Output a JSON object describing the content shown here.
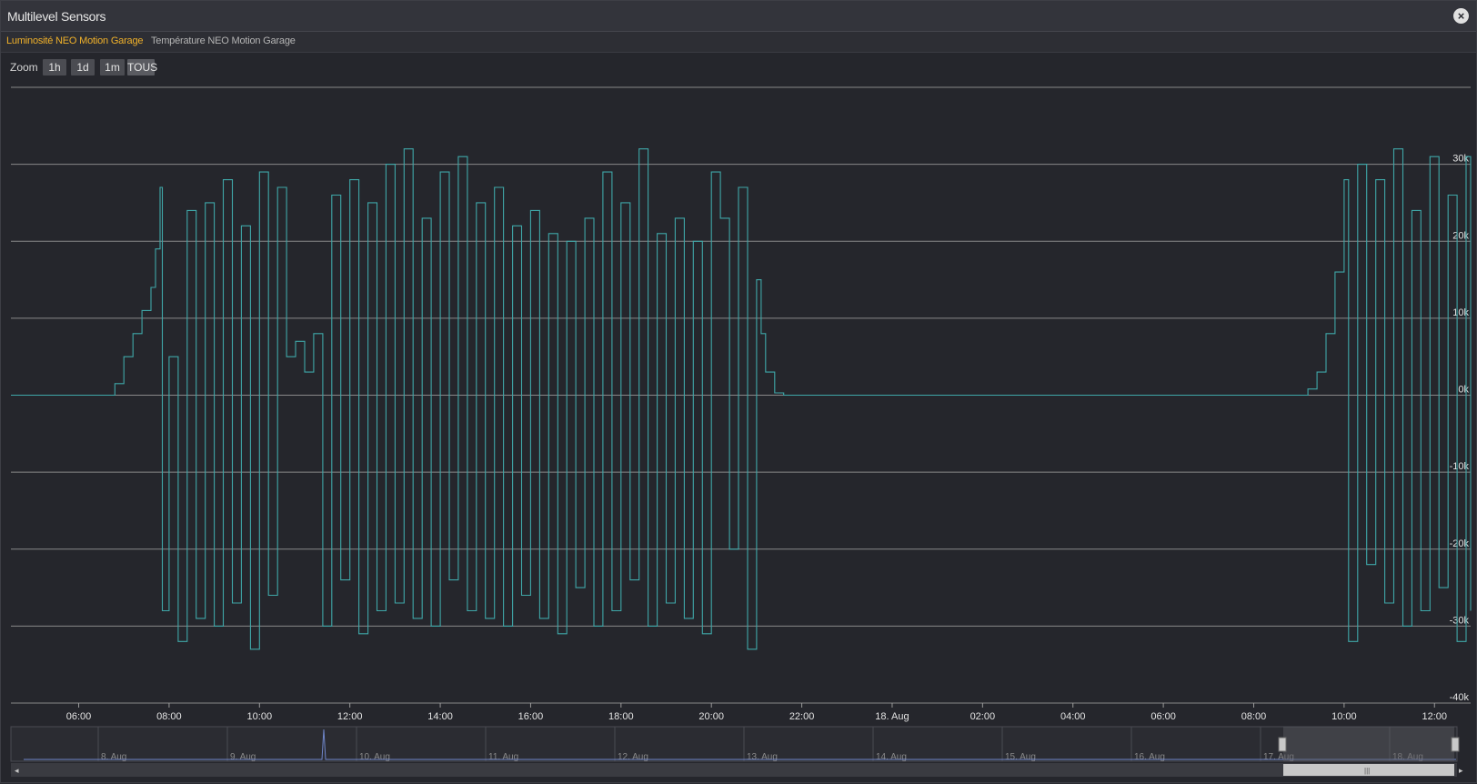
{
  "window": {
    "title": "Multilevel Sensors"
  },
  "tabs": [
    {
      "label": "Luminosité NEO Motion Garage"
    },
    {
      "label": "Température NEO Motion Garage"
    }
  ],
  "zoom": {
    "label": "Zoom",
    "buttons": [
      "1h",
      "1d",
      "1m",
      "TOUS"
    ]
  },
  "colors": {
    "series": "#3fa7a8",
    "active_tab": "#f0b12a",
    "nav_line": "#6f86c9"
  },
  "chart_data": {
    "type": "line",
    "title": "",
    "xlabel": "",
    "ylabel": "",
    "ylim": [
      -40000,
      40000
    ],
    "yticks": [
      "30k",
      "20k",
      "10k",
      "0k",
      "-10k",
      "-20k",
      "-30k",
      "-40k"
    ],
    "x_tick_labels": [
      "06:00",
      "08:00",
      "10:00",
      "12:00",
      "14:00",
      "16:00",
      "18:00",
      "20:00",
      "22:00",
      "18. Aug",
      "02:00",
      "04:00",
      "06:00",
      "08:00",
      "10:00",
      "12:00"
    ],
    "x_range_hours": [
      4.5,
      36.8
    ],
    "grid": true,
    "series": [
      {
        "points": [
          [
            4.5,
            0
          ],
          [
            6.6,
            0
          ],
          [
            6.8,
            1500
          ],
          [
            7.0,
            5000
          ],
          [
            7.2,
            8000
          ],
          [
            7.4,
            11000
          ],
          [
            7.6,
            14000
          ],
          [
            7.7,
            19000
          ],
          [
            7.8,
            27000
          ],
          [
            7.85,
            -28000
          ],
          [
            8.0,
            5000
          ],
          [
            8.2,
            -32000
          ],
          [
            8.4,
            24000
          ],
          [
            8.6,
            -29000
          ],
          [
            8.8,
            25000
          ],
          [
            9.0,
            -30000
          ],
          [
            9.2,
            28000
          ],
          [
            9.4,
            -27000
          ],
          [
            9.6,
            22000
          ],
          [
            9.8,
            -33000
          ],
          [
            10.0,
            29000
          ],
          [
            10.2,
            -26000
          ],
          [
            10.4,
            27000
          ],
          [
            10.6,
            5000
          ],
          [
            10.8,
            7000
          ],
          [
            11.0,
            3000
          ],
          [
            11.2,
            8000
          ],
          [
            11.4,
            -30000
          ],
          [
            11.6,
            26000
          ],
          [
            11.8,
            -24000
          ],
          [
            12.0,
            28000
          ],
          [
            12.2,
            -31000
          ],
          [
            12.4,
            25000
          ],
          [
            12.6,
            -28000
          ],
          [
            12.8,
            30000
          ],
          [
            13.0,
            -27000
          ],
          [
            13.2,
            32000
          ],
          [
            13.4,
            -29000
          ],
          [
            13.6,
            23000
          ],
          [
            13.8,
            -30000
          ],
          [
            14.0,
            29000
          ],
          [
            14.2,
            -24000
          ],
          [
            14.4,
            31000
          ],
          [
            14.6,
            -28000
          ],
          [
            14.8,
            25000
          ],
          [
            15.0,
            -29000
          ],
          [
            15.2,
            27000
          ],
          [
            15.4,
            -30000
          ],
          [
            15.6,
            22000
          ],
          [
            15.8,
            -26000
          ],
          [
            16.0,
            24000
          ],
          [
            16.2,
            -29000
          ],
          [
            16.4,
            21000
          ],
          [
            16.6,
            -31000
          ],
          [
            16.8,
            20000
          ],
          [
            17.0,
            -25000
          ],
          [
            17.2,
            23000
          ],
          [
            17.4,
            -30000
          ],
          [
            17.6,
            29000
          ],
          [
            17.8,
            -28000
          ],
          [
            18.0,
            25000
          ],
          [
            18.2,
            -24000
          ],
          [
            18.4,
            32000
          ],
          [
            18.6,
            -30000
          ],
          [
            18.8,
            21000
          ],
          [
            19.0,
            -27000
          ],
          [
            19.2,
            23000
          ],
          [
            19.4,
            -29000
          ],
          [
            19.6,
            20000
          ],
          [
            19.8,
            -31000
          ],
          [
            20.0,
            29000
          ],
          [
            20.2,
            23000
          ],
          [
            20.4,
            -20000
          ],
          [
            20.6,
            27000
          ],
          [
            20.8,
            -33000
          ],
          [
            21.0,
            15000
          ],
          [
            21.1,
            8000
          ],
          [
            21.2,
            3000
          ],
          [
            21.4,
            300
          ],
          [
            21.6,
            0
          ],
          [
            33.0,
            0
          ],
          [
            33.2,
            800
          ],
          [
            33.4,
            3000
          ],
          [
            33.6,
            8000
          ],
          [
            33.8,
            16000
          ],
          [
            34.0,
            28000
          ],
          [
            34.1,
            -32000
          ],
          [
            34.3,
            30000
          ],
          [
            34.5,
            -22000
          ],
          [
            34.7,
            28000
          ],
          [
            34.9,
            -27000
          ],
          [
            35.1,
            32000
          ],
          [
            35.3,
            -30000
          ],
          [
            35.5,
            24000
          ],
          [
            35.7,
            -28000
          ],
          [
            35.9,
            31000
          ],
          [
            36.1,
            -25000
          ],
          [
            36.3,
            26000
          ],
          [
            36.5,
            -32000
          ],
          [
            36.7,
            31000
          ],
          [
            36.8,
            -28000
          ]
        ]
      }
    ],
    "navigator": {
      "tick_labels": [
        "8. Aug",
        "9. Aug",
        "10. Aug",
        "11. Aug",
        "12. Aug",
        "13. Aug",
        "14. Aug",
        "15. Aug",
        "16. Aug",
        "17. Aug",
        "18. Aug"
      ]
    }
  }
}
